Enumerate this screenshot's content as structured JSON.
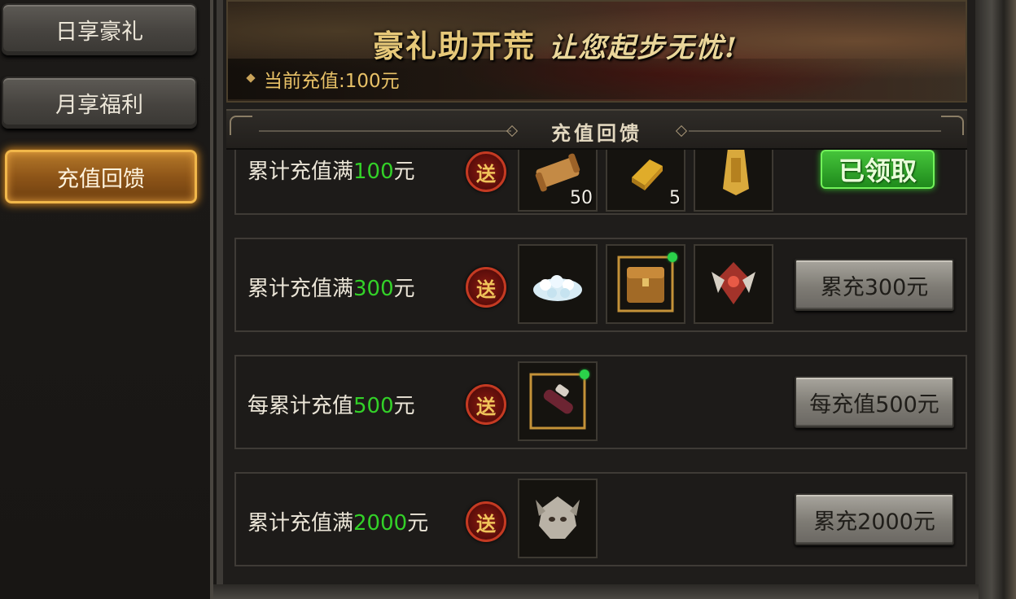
{
  "sidebar": {
    "items": [
      {
        "label": "日享豪礼",
        "active": false
      },
      {
        "label": "月享福利",
        "active": false
      },
      {
        "label": "充值回馈",
        "active": true
      }
    ]
  },
  "banner": {
    "slogan_main": "豪礼助开荒",
    "slogan_sub": "让您起步无忧!",
    "current_recharge_label": "当前充值:",
    "current_recharge_value": "100元"
  },
  "section": {
    "title": "充值回馈"
  },
  "rows": [
    {
      "label_prefix": "累计充值满",
      "amount": "100",
      "unit": "元",
      "badge": "送",
      "items": [
        {
          "icon": "scroll-icon",
          "qty": "50"
        },
        {
          "icon": "gold-bar-icon",
          "qty": "5"
        },
        {
          "icon": "gold-talisman-icon",
          "qty": ""
        }
      ],
      "action": "已领取",
      "claimed": true
    },
    {
      "label_prefix": "累计充值满",
      "amount": "300",
      "unit": "元",
      "badge": "送",
      "items": [
        {
          "icon": "diamond-pile-icon",
          "qty": ""
        },
        {
          "icon": "treasure-chest-icon",
          "qty": ""
        },
        {
          "icon": "red-emblem-icon",
          "qty": ""
        }
      ],
      "action": "累充300元",
      "claimed": false
    },
    {
      "label_prefix": "每累计充值",
      "amount": "500",
      "unit": "元",
      "badge": "送",
      "items": [
        {
          "icon": "scroll-case-icon",
          "qty": ""
        }
      ],
      "action": "每充值500元",
      "claimed": false
    },
    {
      "label_prefix": "累计充值满",
      "amount": "2000",
      "unit": "元",
      "badge": "送",
      "items": [
        {
          "icon": "dragon-helmet-icon",
          "qty": ""
        }
      ],
      "action": "累充2000元",
      "claimed": false
    }
  ],
  "colors": {
    "amount": "#33d128",
    "accent": "#e8c167",
    "active_tab": "#f1b74a"
  }
}
